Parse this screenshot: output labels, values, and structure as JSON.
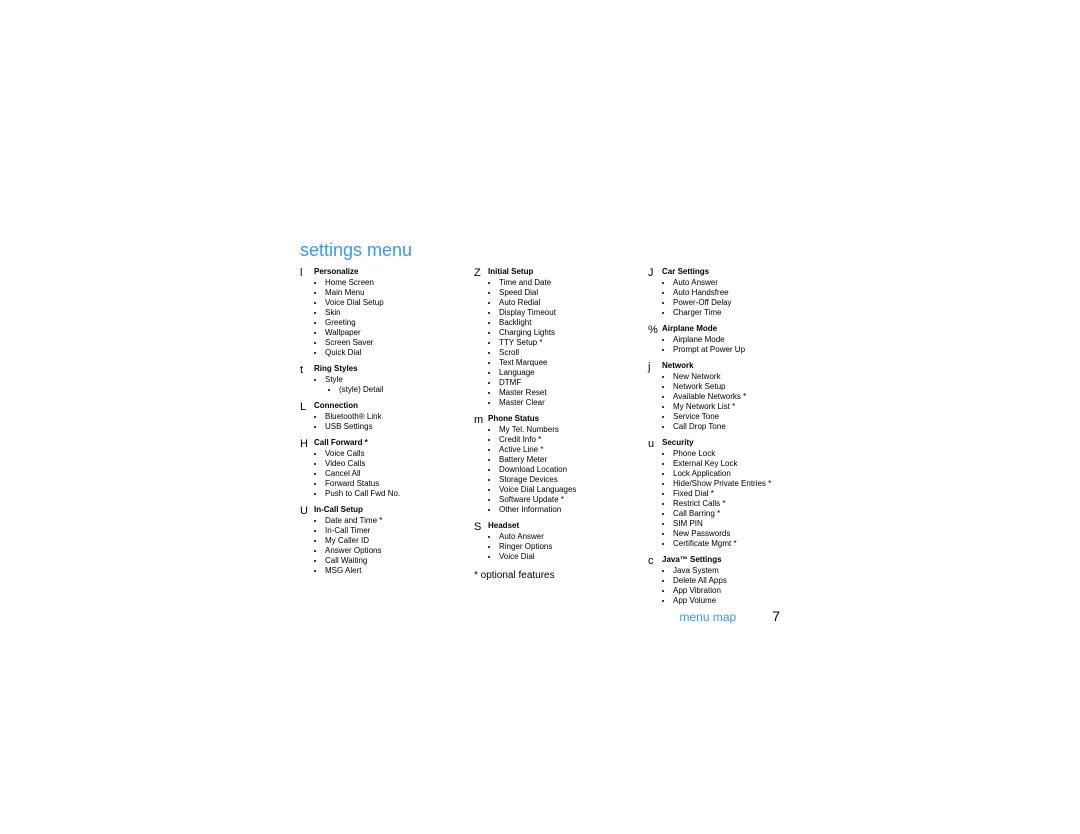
{
  "title": "settings menu",
  "footnote": "* optional features",
  "footer_label": "menu map",
  "footer_page": "7",
  "columns": [
    [
      {
        "symbol": "l",
        "title": "Personalize",
        "items": [
          {
            "t": "Home Screen"
          },
          {
            "t": "Main Menu"
          },
          {
            "t": "Voice Dial Setup"
          },
          {
            "t": "Skin"
          },
          {
            "t": "Greeting"
          },
          {
            "t": "Wallpaper"
          },
          {
            "t": "Screen Saver"
          },
          {
            "t": "Quick Dial"
          }
        ]
      },
      {
        "symbol": "t",
        "title": "Ring Styles",
        "items": [
          {
            "t": "Style",
            "subs": [
              "(style) Detail"
            ]
          }
        ]
      },
      {
        "symbol": "L",
        "title": "Connection",
        "items": [
          {
            "t": "Bluetooth® Link"
          },
          {
            "t": "USB Settings"
          }
        ]
      },
      {
        "symbol": "H",
        "title": "Call Forward *",
        "items": [
          {
            "t": "Voice Calls"
          },
          {
            "t": "Video Calls"
          },
          {
            "t": "Cancel All"
          },
          {
            "t": "Forward Status"
          },
          {
            "t": "Push to Call Fwd No."
          }
        ]
      },
      {
        "symbol": "U",
        "title": "In-Call Setup",
        "items": [
          {
            "t": "Date and Time *"
          },
          {
            "t": "In-Call Timer"
          },
          {
            "t": "My Caller ID"
          },
          {
            "t": "Answer Options"
          },
          {
            "t": "Call Waiting"
          },
          {
            "t": "MSG Alert"
          }
        ]
      }
    ],
    [
      {
        "symbol": "Z",
        "title": "Initial Setup",
        "items": [
          {
            "t": "Time and Date"
          },
          {
            "t": "Speed Dial"
          },
          {
            "t": "Auto Redial"
          },
          {
            "t": "Display Timeout"
          },
          {
            "t": "Backlight"
          },
          {
            "t": "Charging Lights"
          },
          {
            "t": "TTY Setup *"
          },
          {
            "t": "Scroll"
          },
          {
            "t": "Text Marquee"
          },
          {
            "t": "Language"
          },
          {
            "t": "DTMF"
          },
          {
            "t": "Master Reset"
          },
          {
            "t": "Master Clear"
          }
        ]
      },
      {
        "symbol": "m",
        "title": "Phone Status",
        "items": [
          {
            "t": "My Tel. Numbers"
          },
          {
            "t": "Credit Info *"
          },
          {
            "t": "Active Line *"
          },
          {
            "t": "Battery Meter"
          },
          {
            "t": "Download Location"
          },
          {
            "t": "Storage Devices"
          },
          {
            "t": "Voice Dial Languages"
          },
          {
            "t": "Software Update *"
          },
          {
            "t": "Other Information"
          }
        ]
      },
      {
        "symbol": "S",
        "title": "Headset",
        "items": [
          {
            "t": "Auto Answer"
          },
          {
            "t": "Ringer Options"
          },
          {
            "t": "Voice Dial"
          }
        ]
      }
    ],
    [
      {
        "symbol": "J",
        "title": "Car Settings",
        "items": [
          {
            "t": "Auto Answer"
          },
          {
            "t": "Auto Handsfree"
          },
          {
            "t": "Power-Off Delay"
          },
          {
            "t": "Charger Time"
          }
        ]
      },
      {
        "symbol": "%",
        "title": "Airplane Mode",
        "items": [
          {
            "t": "Airplane Mode"
          },
          {
            "t": "Prompt at Power Up"
          }
        ]
      },
      {
        "symbol": "j",
        "title": "Network",
        "items": [
          {
            "t": "New Network"
          },
          {
            "t": "Network Setup"
          },
          {
            "t": "Available Networks *"
          },
          {
            "t": "My Network List *"
          },
          {
            "t": "Service Tone"
          },
          {
            "t": "Call Drop Tone"
          }
        ]
      },
      {
        "symbol": "u",
        "title": "Security",
        "items": [
          {
            "t": "Phone Lock"
          },
          {
            "t": "External Key Lock"
          },
          {
            "t": "Lock Application"
          },
          {
            "t": "Hide/Show Private Entries *"
          },
          {
            "t": "Fixed Dial *"
          },
          {
            "t": "Restrict Calls *"
          },
          {
            "t": "Call Barring *"
          },
          {
            "t": "SIM PIN"
          },
          {
            "t": "New Passwords"
          },
          {
            "t": "Certificate Mgmt *"
          }
        ]
      },
      {
        "symbol": "c",
        "title": "Java™ Settings",
        "items": [
          {
            "t": "Java System"
          },
          {
            "t": "Delete All Apps"
          },
          {
            "t": "App Vibration"
          },
          {
            "t": "App Volume"
          }
        ]
      }
    ]
  ]
}
